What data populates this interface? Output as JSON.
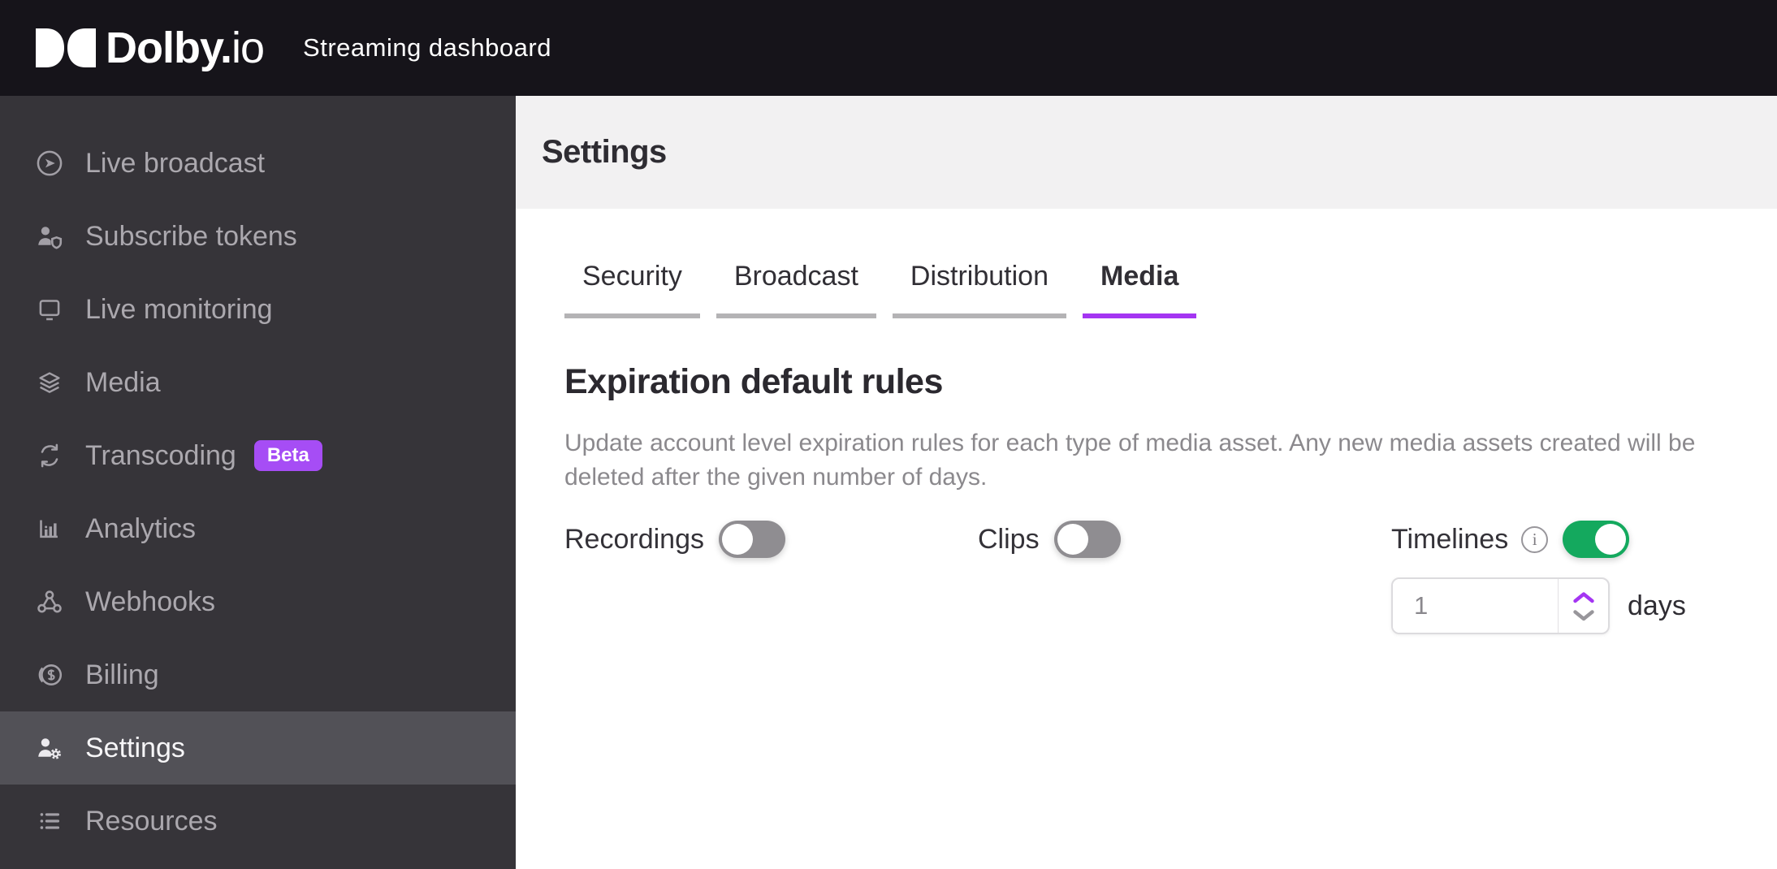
{
  "header": {
    "logo_symbol_icon": "dolby-double-d-logo",
    "logo_text_bold": "Dolby.",
    "logo_text_light": "io",
    "app_title": "Streaming dashboard"
  },
  "sidebar": {
    "items": [
      {
        "label": "Live broadcast",
        "icon": "live-broadcast-icon",
        "active": false
      },
      {
        "label": "Subscribe tokens",
        "icon": "subscribe-tokens-icon",
        "active": false
      },
      {
        "label": "Live monitoring",
        "icon": "live-monitoring-icon",
        "active": false
      },
      {
        "label": "Media",
        "icon": "media-layers-icon",
        "active": false
      },
      {
        "label": "Transcoding",
        "icon": "transcoding-sync-icon",
        "active": false,
        "badge": "Beta"
      },
      {
        "label": "Analytics",
        "icon": "analytics-chart-icon",
        "active": false
      },
      {
        "label": "Webhooks",
        "icon": "webhooks-icon",
        "active": false
      },
      {
        "label": "Billing",
        "icon": "billing-coin-icon",
        "active": false
      },
      {
        "label": "Settings",
        "icon": "settings-user-gear-icon",
        "active": true
      },
      {
        "label": "Resources",
        "icon": "resources-list-icon",
        "active": false
      }
    ]
  },
  "page": {
    "title": "Settings"
  },
  "tabs": [
    {
      "label": "Security",
      "active": false
    },
    {
      "label": "Broadcast",
      "active": false
    },
    {
      "label": "Distribution",
      "active": false
    },
    {
      "label": "Media",
      "active": true
    }
  ],
  "section": {
    "heading": "Expiration default rules",
    "description": "Update account level expiration rules for each type of media asset. Any new media assets created will be deleted after the given number of days."
  },
  "controls": {
    "recordings": {
      "label": "Recordings",
      "enabled": false
    },
    "clips": {
      "label": "Clips",
      "enabled": false
    },
    "timelines": {
      "label": "Timelines",
      "enabled": true,
      "info_icon": "info-icon"
    },
    "expiration": {
      "value": "1",
      "unit_label": "days",
      "up_icon": "chevron-up-icon",
      "down_icon": "chevron-down-icon"
    }
  },
  "colors": {
    "header_bg": "#16141a",
    "sidebar_bg": "#363439",
    "sidebar_active_bg": "#525157",
    "accent_purple": "#a435f2",
    "beta_badge_purple": "#a64df5",
    "toggle_on_green": "#14a95e",
    "toggle_off_gray": "#8f8d91",
    "page_band_gray": "#f2f1f2",
    "tab_track_gray": "#b4b3b5"
  }
}
